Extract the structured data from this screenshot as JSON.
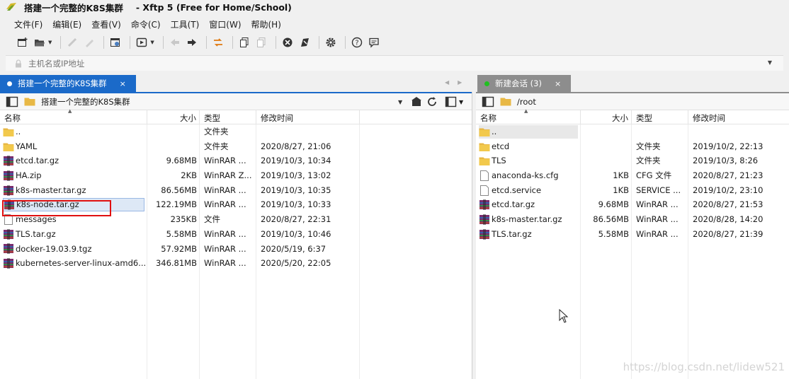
{
  "window": {
    "title": "搭建一个完整的K8S集群",
    "app_title": "- Xftp 5 (Free for Home/School)"
  },
  "menu": [
    "文件(F)",
    "编辑(E)",
    "查看(V)",
    "命令(C)",
    "工具(T)",
    "窗口(W)",
    "帮助(H)"
  ],
  "address": {
    "placeholder": "主机名或IP地址"
  },
  "left_tab": {
    "label": "搭建一个完整的K8S集群",
    "close": "×"
  },
  "right_tab": {
    "label": "新建会话 (3)",
    "close": "×"
  },
  "left_pane": {
    "path": "搭建一个完整的K8S集群",
    "columns": [
      "名称",
      "大小",
      "类型",
      "修改时间"
    ],
    "rows": [
      {
        "name": "..",
        "size": "",
        "type": "文件夹",
        "modified": "",
        "icon": "folder-icon"
      },
      {
        "name": "YAML",
        "size": "",
        "type": "文件夹",
        "modified": "2020/8/27, 21:06",
        "icon": "folder-icon"
      },
      {
        "name": "etcd.tar.gz",
        "size": "9.68MB",
        "type": "WinRAR ...",
        "modified": "2019/10/3, 10:34",
        "icon": "winrar-icon"
      },
      {
        "name": "HA.zip",
        "size": "2KB",
        "type": "WinRAR Z...",
        "modified": "2019/10/3, 13:02",
        "icon": "winrar-icon"
      },
      {
        "name": "k8s-master.tar.gz",
        "size": "86.56MB",
        "type": "WinRAR ...",
        "modified": "2019/10/3, 10:35",
        "icon": "winrar-icon"
      },
      {
        "name": "k8s-node.tar.gz",
        "size": "122.19MB",
        "type": "WinRAR ...",
        "modified": "2019/10/3, 10:33",
        "icon": "winrar-icon"
      },
      {
        "name": "messages",
        "size": "235KB",
        "type": "文件",
        "modified": "2020/8/27, 22:31",
        "icon": "file-icon"
      },
      {
        "name": "TLS.tar.gz",
        "size": "5.58MB",
        "type": "WinRAR ...",
        "modified": "2019/10/3, 10:46",
        "icon": "winrar-icon"
      },
      {
        "name": "docker-19.03.9.tgz",
        "size": "57.92MB",
        "type": "WinRAR ...",
        "modified": "2020/5/19, 6:37",
        "icon": "winrar-icon"
      },
      {
        "name": "kubernetes-server-linux-amd6...",
        "size": "346.81MB",
        "type": "WinRAR ...",
        "modified": "2020/5/20, 22:05",
        "icon": "winrar-icon"
      }
    ]
  },
  "right_pane": {
    "path": "/root",
    "columns": [
      "名称",
      "大小",
      "类型",
      "修改时间"
    ],
    "rows": [
      {
        "name": "..",
        "size": "",
        "type": "",
        "modified": "",
        "icon": "folder-icon"
      },
      {
        "name": "etcd",
        "size": "",
        "type": "文件夹",
        "modified": "2019/10/2, 22:13",
        "icon": "folder-icon"
      },
      {
        "name": "TLS",
        "size": "",
        "type": "文件夹",
        "modified": "2019/10/3, 8:26",
        "icon": "folder-icon"
      },
      {
        "name": "anaconda-ks.cfg",
        "size": "1KB",
        "type": "CFG 文件",
        "modified": "2020/8/27, 21:23",
        "icon": "file-icon"
      },
      {
        "name": "etcd.service",
        "size": "1KB",
        "type": "SERVICE ...",
        "modified": "2019/10/2, 23:10",
        "icon": "file-icon"
      },
      {
        "name": "etcd.tar.gz",
        "size": "9.68MB",
        "type": "WinRAR ...",
        "modified": "2020/8/27, 21:53",
        "icon": "winrar-icon"
      },
      {
        "name": "k8s-master.tar.gz",
        "size": "86.56MB",
        "type": "WinRAR ...",
        "modified": "2020/8/28, 14:20",
        "icon": "winrar-icon"
      },
      {
        "name": "TLS.tar.gz",
        "size": "5.58MB",
        "type": "WinRAR ...",
        "modified": "2020/8/27, 21:39",
        "icon": "winrar-icon"
      }
    ]
  },
  "watermark": "https://blog.csdn.net/lidew521",
  "colors": {
    "accent": "#1b6ac9",
    "inactive_tab": "#8d8d8d",
    "highlight_border": "#e01010",
    "folder": "#e8b845"
  }
}
